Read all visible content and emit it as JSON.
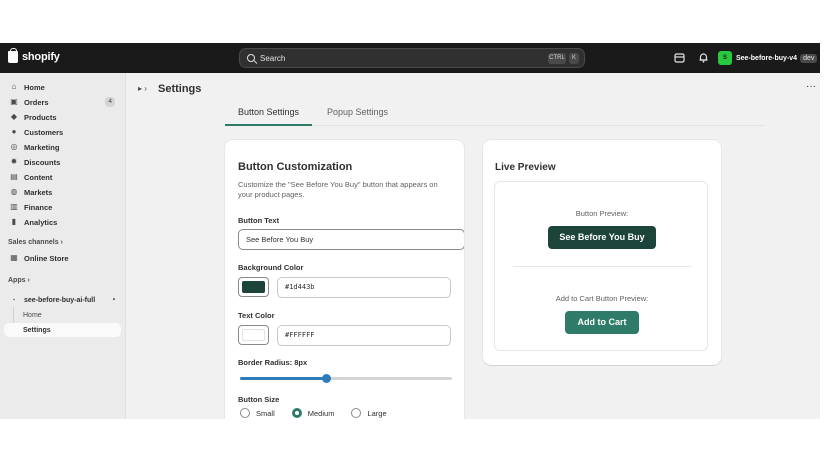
{
  "topbar": {
    "brand": "shopify",
    "search_placeholder": "Search",
    "shortcut_ctrl": "CTRL",
    "shortcut_key": "K",
    "store_name": "See-before-buy-v4",
    "store_avatar": "S",
    "store_tag": "dev"
  },
  "sidebar": {
    "items": [
      {
        "label": "Home",
        "icon": "home-icon"
      },
      {
        "label": "Orders",
        "icon": "orders-icon",
        "badge": "4"
      },
      {
        "label": "Products",
        "icon": "tag-icon"
      },
      {
        "label": "Customers",
        "icon": "person-icon"
      },
      {
        "label": "Marketing",
        "icon": "target-icon"
      },
      {
        "label": "Discounts",
        "icon": "discount-icon"
      },
      {
        "label": "Content",
        "icon": "content-icon"
      },
      {
        "label": "Markets",
        "icon": "globe-icon"
      },
      {
        "label": "Finance",
        "icon": "bank-icon"
      },
      {
        "label": "Analytics",
        "icon": "chart-icon"
      }
    ],
    "sales_channels_heading": "Sales channels",
    "online_store": "Online Store",
    "apps_heading": "Apps",
    "app_name": "see-before-buy-ai-full",
    "app_sub": [
      "Home",
      "Settings"
    ]
  },
  "page": {
    "title": "Settings",
    "tabs": [
      "Button Settings",
      "Popup Settings"
    ]
  },
  "customization": {
    "heading": "Button Customization",
    "description": "Customize the \"See Before You Buy\" button that appears on your product pages.",
    "button_text_label": "Button Text",
    "button_text_value": "See Before You Buy",
    "bg_color_label": "Background Color",
    "bg_color_value": "#1d443b",
    "text_color_label": "Text Color",
    "text_color_value": "#FFFFFF",
    "border_radius_label": "Border Radius: 8px",
    "border_radius_fraction": 0.41,
    "button_size_label": "Button Size",
    "sizes": [
      "Small",
      "Medium",
      "Large"
    ],
    "selected_size": "Medium"
  },
  "preview": {
    "heading": "Live Preview",
    "button_preview_label": "Button Preview:",
    "button_preview_text": "See Before You Buy",
    "cart_preview_label": "Add to Cart Button Preview:",
    "cart_button_text": "Add to Cart",
    "button_bg": "#1d443b",
    "cart_bg": "#2f7b69"
  }
}
